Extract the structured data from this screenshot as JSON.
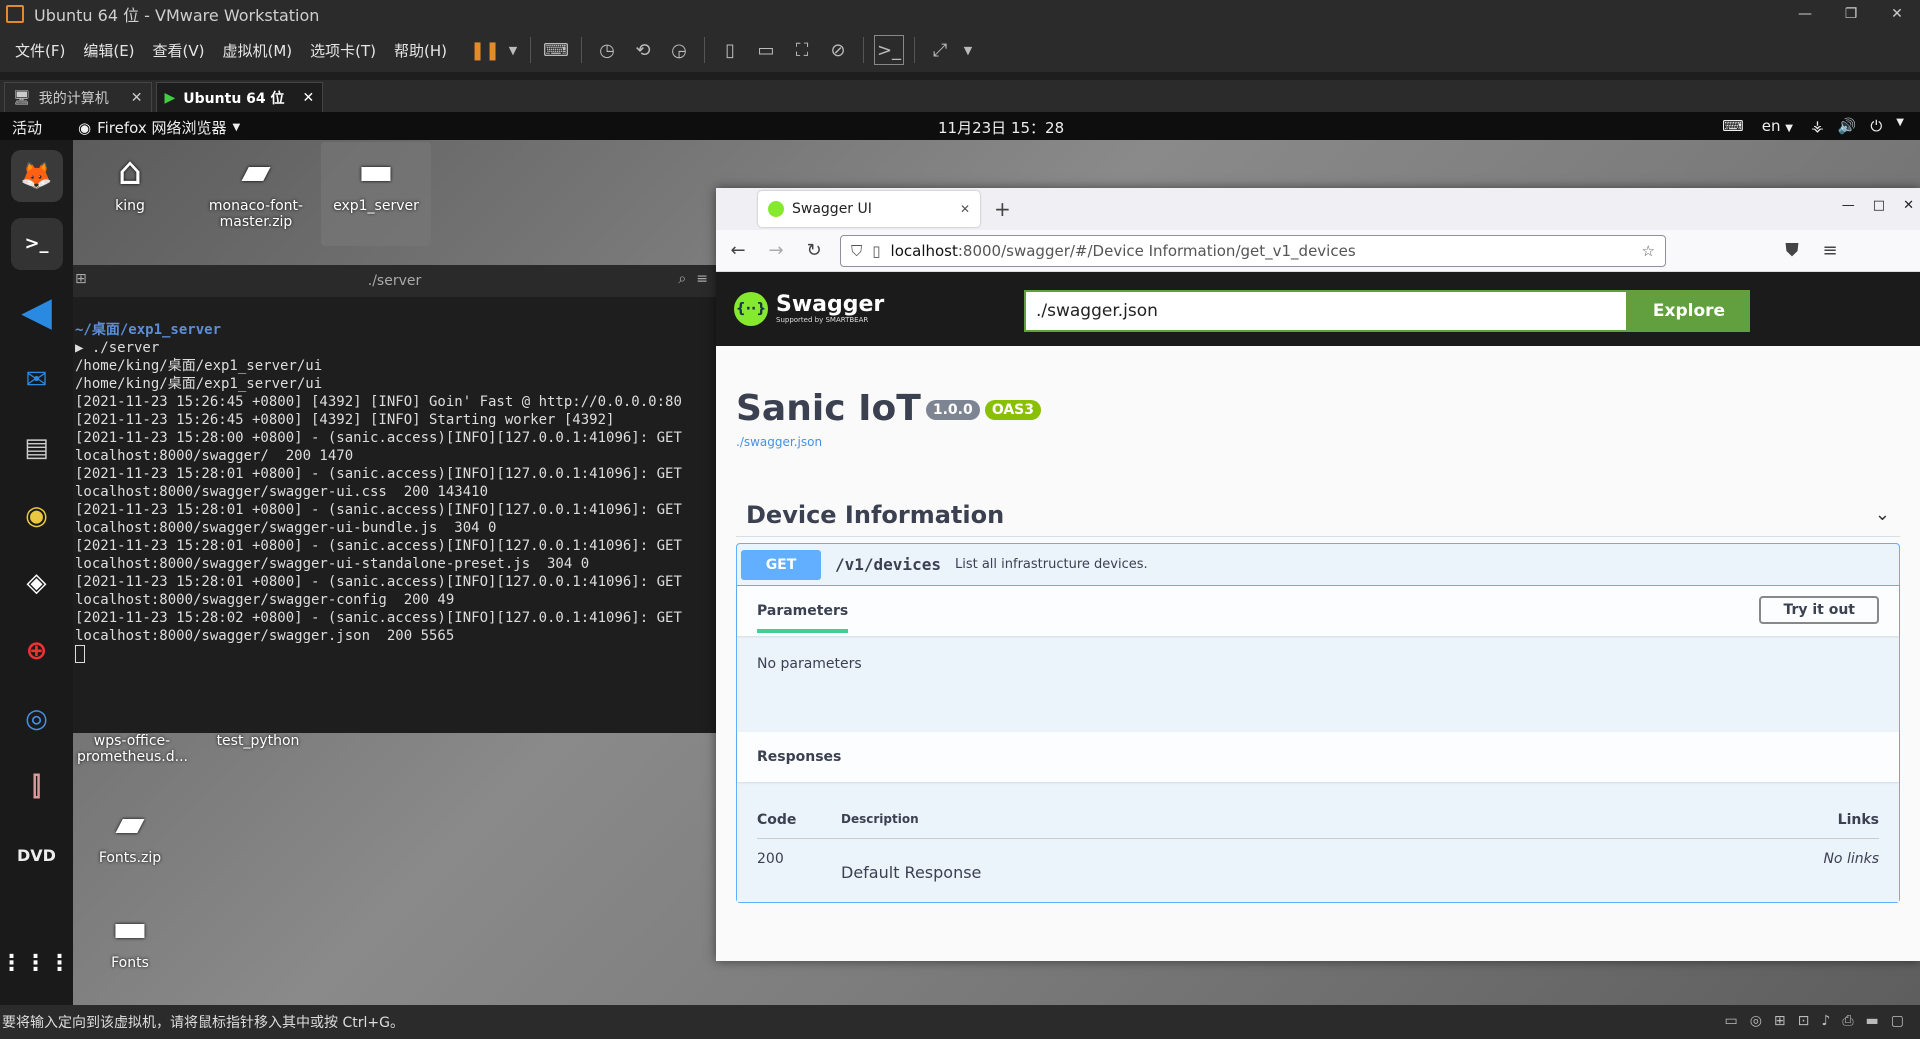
{
  "vmware": {
    "title": "Ubuntu 64 位 - VMware Workstation",
    "menu": [
      "文件(F)",
      "编辑(E)",
      "查看(V)",
      "虚拟机(M)",
      "选项卡(T)",
      "帮助(H)"
    ],
    "tabs": [
      {
        "label": "我的计算机"
      },
      {
        "label": "Ubuntu 64 位"
      }
    ],
    "status_text": "要将输入定向到该虚拟机，请将鼠标指针移入其中或按 Ctrl+G。"
  },
  "gnome": {
    "activities": "活动",
    "app_menu": "Firefox 网络浏览器",
    "clock": "11月23日 15：28",
    "lang": "en"
  },
  "desktop": {
    "icons": [
      "king",
      "monaco-font-master.zip",
      "exp1_server",
      "wps-office-prometheus.d...",
      "test_python",
      "Fonts.zip",
      "Fonts"
    ]
  },
  "terminal": {
    "title": "./server",
    "prompt_path": "~/桌面/exp1_server",
    "lines": [
      "▶ ./server",
      "/home/king/桌面/exp1_server/ui",
      "/home/king/桌面/exp1_server/ui",
      "[2021-11-23 15:26:45 +0800] [4392] [INFO] Goin' Fast @ http://0.0.0.0:80",
      "[2021-11-23 15:26:45 +0800] [4392] [INFO] Starting worker [4392]",
      "[2021-11-23 15:28:00 +0800] - (sanic.access)[INFO][127.0.0.1:41096]: GET",
      "localhost:8000/swagger/  200 1470",
      "[2021-11-23 15:28:01 +0800] - (sanic.access)[INFO][127.0.0.1:41096]: GET",
      "localhost:8000/swagger/swagger-ui.css  200 143410",
      "[2021-11-23 15:28:01 +0800] - (sanic.access)[INFO][127.0.0.1:41096]: GET",
      "localhost:8000/swagger/swagger-ui-bundle.js  304 0",
      "[2021-11-23 15:28:01 +0800] - (sanic.access)[INFO][127.0.0.1:41096]: GET",
      "localhost:8000/swagger/swagger-ui-standalone-preset.js  304 0",
      "[2021-11-23 15:28:01 +0800] - (sanic.access)[INFO][127.0.0.1:41096]: GET",
      "localhost:8000/swagger/swagger-config  200 49",
      "[2021-11-23 15:28:02 +0800] - (sanic.access)[INFO][127.0.0.1:41096]: GET",
      "localhost:8000/swagger/swagger.json  200 5565"
    ]
  },
  "firefox": {
    "tab_title": "Swagger UI",
    "url_host": "localhost",
    "url_rest": ":8000/swagger/#/Device Information/get_v1_devices"
  },
  "swagger": {
    "logo_text": "Swagger",
    "logo_sub": "Supported by SMARTBEAR",
    "spec_url": "./swagger.json",
    "explore": "Explore",
    "api_title": "Sanic IoT",
    "version": "1.0.0",
    "oas": "OAS3",
    "link": "./swagger.json",
    "tag": "Device Information",
    "op": {
      "method": "GET",
      "path": "/v1/devices",
      "summary": "List all infrastructure devices.",
      "params_tab": "Parameters",
      "try_btn": "Try it out",
      "no_params": "No parameters",
      "responses_hdr": "Responses",
      "col_code": "Code",
      "col_desc": "Description",
      "col_links": "Links",
      "resp_code": "200",
      "resp_desc": "Default Response",
      "resp_links": "No links"
    }
  },
  "colors": {
    "get": "#61affe",
    "swagger_green": "#62a03f",
    "swagger_dark": "#1b1b1b"
  }
}
